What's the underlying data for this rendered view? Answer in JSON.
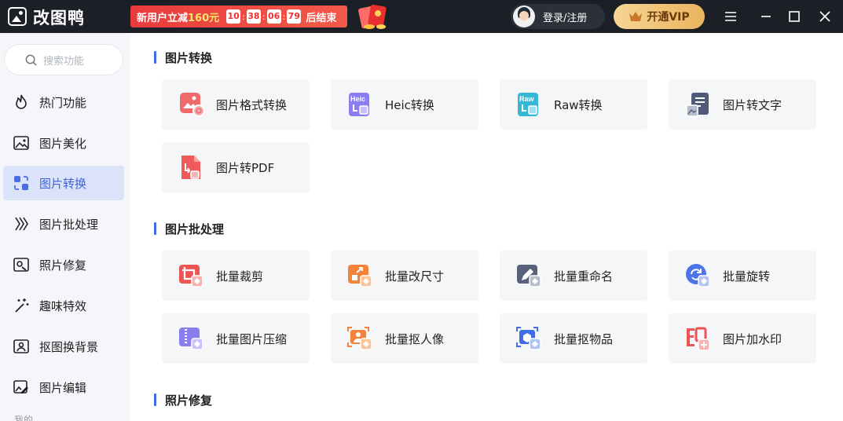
{
  "app": {
    "title": "改图鸭"
  },
  "promo": {
    "text_prefix": "新用户立减",
    "amount": "160元",
    "hours": "10",
    "minutes": "38",
    "seconds": "06",
    "centis": "79",
    "suffix": "后结束"
  },
  "header": {
    "login_label": "登录/注册",
    "vip_label": "开通VIP"
  },
  "sidebar": {
    "search_placeholder": "搜索功能",
    "items": [
      {
        "label": "热门功能",
        "icon": "flame-icon"
      },
      {
        "label": "图片美化",
        "icon": "image-icon"
      },
      {
        "label": "图片转换",
        "icon": "convert-icon",
        "active": true
      },
      {
        "label": "图片批处理",
        "icon": "layers-icon"
      },
      {
        "label": "照片修复",
        "icon": "photo-repair-icon"
      },
      {
        "label": "趣味特效",
        "icon": "sparkle-icon"
      },
      {
        "label": "抠图换背景",
        "icon": "cutout-icon"
      },
      {
        "label": "图片编辑",
        "icon": "edit-image-icon"
      }
    ],
    "more_label": "我的"
  },
  "sections": [
    {
      "title": "图片转换",
      "cards": [
        {
          "label": "图片格式转换",
          "icon": "format-convert-icon",
          "color": "#ef6a6a"
        },
        {
          "label": "Heic转换",
          "icon": "heic-icon",
          "color": "#8b7cf0"
        },
        {
          "label": "Raw转换",
          "icon": "raw-icon",
          "color": "#35b8d6"
        },
        {
          "label": "图片转文字",
          "icon": "image-to-text-icon",
          "color": "#4f5a78"
        },
        {
          "label": "图片转PDF",
          "icon": "image-to-pdf-icon",
          "color": "#ef5a5a"
        }
      ]
    },
    {
      "title": "图片批处理",
      "cards": [
        {
          "label": "批量裁剪",
          "icon": "batch-crop-icon",
          "color": "#ee5454"
        },
        {
          "label": "批量改尺寸",
          "icon": "batch-resize-icon",
          "color": "#f3823a"
        },
        {
          "label": "批量重命名",
          "icon": "batch-rename-icon",
          "color": "#58627a"
        },
        {
          "label": "批量旋转",
          "icon": "batch-rotate-icon",
          "color": "#4b74e8"
        },
        {
          "label": "批量图片压缩",
          "icon": "batch-compress-icon",
          "color": "#8b7cf0"
        },
        {
          "label": "批量抠人像",
          "icon": "batch-portrait-cutout-icon",
          "color": "#f3823a"
        },
        {
          "label": "批量抠物品",
          "icon": "batch-object-cutout-icon",
          "color": "#3f6de8"
        },
        {
          "label": "图片加水印",
          "icon": "watermark-icon",
          "color": "#ee5454"
        }
      ]
    },
    {
      "title": "照片修复",
      "cards": []
    }
  ]
}
